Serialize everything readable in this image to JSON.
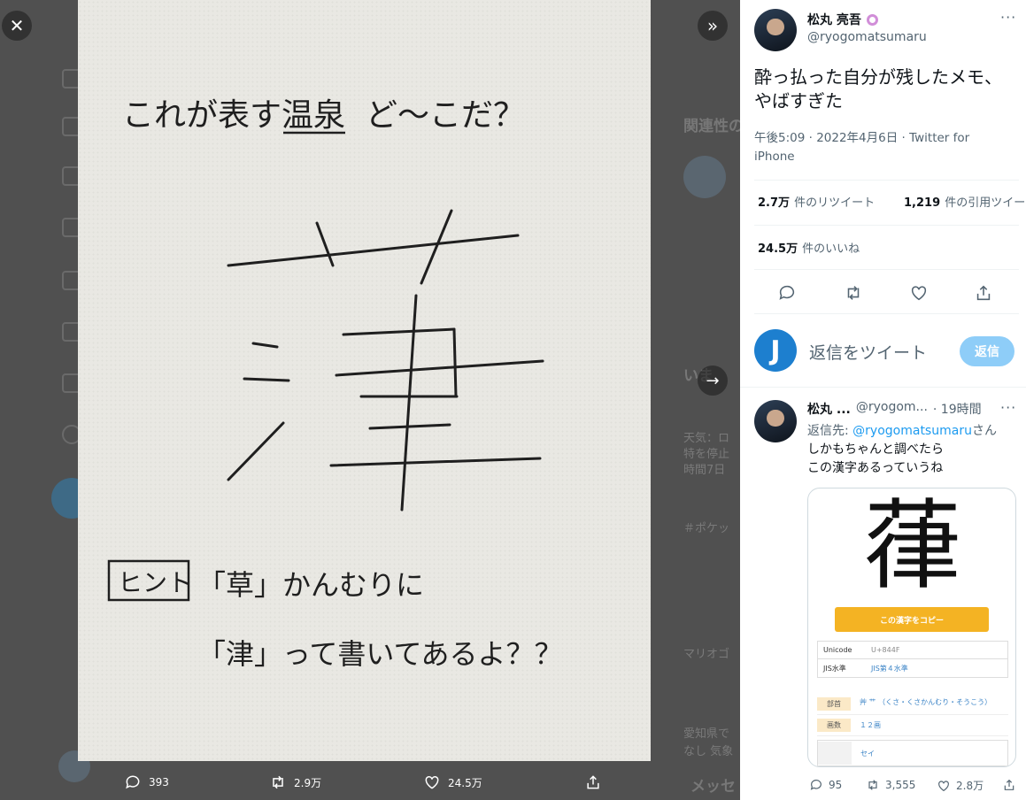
{
  "media": {
    "photo_lines": {
      "question_a": "これが表す",
      "question_b": "温泉",
      "question_c": "ど〜こだ？",
      "hint_box": "ヒント",
      "hint_line1": "「草」かんむりに",
      "hint_line2": "「津」って書いてあるよ？？"
    },
    "reply_count": "393",
    "retweet_count": "2.9万",
    "like_count": "24.5万"
  },
  "tweet": {
    "display_name": "松丸 亮吾",
    "handle": "@ryogomatsumaru",
    "text": "酔っ払った自分が残したメモ、やばすぎた",
    "timestamp": "午後5:09 · 2022年4月6日 · Twitter for iPhone",
    "stats": {
      "retweets_num": "2.7万",
      "retweets_label": "件のリツイート",
      "quotes_num": "1,219",
      "quotes_label": "件の引用ツイート",
      "likes_num": "24.5万",
      "likes_label": "件のいいね"
    }
  },
  "composer": {
    "avatar_letter": "J",
    "placeholder": "返信をツイート",
    "reply_button": "返信"
  },
  "reply": {
    "display_name": "松丸 ...",
    "handle": "@ryogom...",
    "time": "· 19時間",
    "reply_to_prefix": "返信先: ",
    "reply_to_handle": "@ryogomatsumaru",
    "reply_to_suffix": "さん",
    "text": "しかもちゃんと調べたらこの漢字あるっていうね",
    "card": {
      "kanji": "葎",
      "copy_button": "この漢字をコピー",
      "table": [
        {
          "label": "Unicode",
          "value": "U+844F"
        },
        {
          "label": "JIS水準",
          "value": "JIS第４水準"
        }
      ],
      "rows": [
        {
          "label": "部首",
          "value": "艸 艹 （くさ・くさかんむり・そうこう）"
        },
        {
          "label": "画数",
          "value": "１２画"
        },
        {
          "label": "",
          "value": "セイ"
        }
      ]
    },
    "reply_count": "95",
    "retweet_count": "3,555",
    "like_count": "2.8万"
  },
  "background": {
    "related_heading": "関連性の",
    "trends_heading": "いま",
    "lines": [
      "天気：ロ",
      "特を停止",
      "時間7日",
      "＃ポケッ",
      "マリオゴ",
      "愛知県で",
      "なし 気象",
      "メッセ"
    ]
  },
  "colors": {
    "accent": "#1d9bf0",
    "reply_button_bg": "#8ecdf8",
    "verified": "#d18ed8"
  }
}
